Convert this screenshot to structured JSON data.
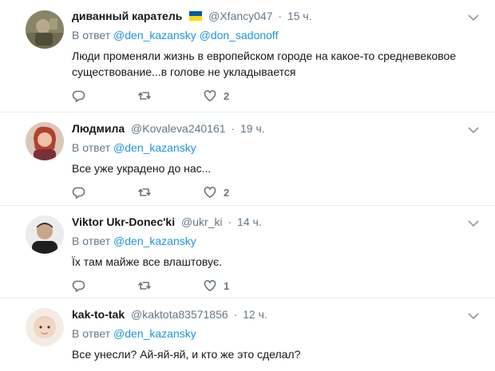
{
  "reply_prefix": "В ответ",
  "tweets": [
    {
      "name": "диванный каратель",
      "has_flag": true,
      "flag_colors": [
        "#0057b7",
        "#ffd700"
      ],
      "handle": "@Xfancy047",
      "separator": "·",
      "time": "15 ч.",
      "mentions": [
        "@den_kazansky",
        "@don_sadonoff"
      ],
      "text": "Люди променяли жизнь в европейском городе на какое-то средневековое существование...в голове не укладывается",
      "likes": "2"
    },
    {
      "name": "Людмила",
      "handle": "@Kovaleva240161",
      "separator": "·",
      "time": "19 ч.",
      "mentions": [
        "@den_kazansky"
      ],
      "text": "Все уже украдено до нас...",
      "likes": "2"
    },
    {
      "name": "Viktor Ukr-Donec'ki",
      "handle": "@ukr_ki",
      "separator": "·",
      "time": "14 ч.",
      "mentions": [
        "@den_kazansky"
      ],
      "text": "Їх там майже все влаштовує.",
      "likes": "1"
    },
    {
      "name": "kak-to-tak",
      "handle": "@kaktota83571856",
      "separator": "·",
      "time": "12 ч.",
      "mentions": [
        "@den_kazansky"
      ],
      "text": "Все унесли? Ай-яй-яй, и кто же это сделал?",
      "likes": ""
    }
  ],
  "icons": {
    "reply": "reply-icon",
    "retweet": "retweet-icon",
    "like": "heart-icon",
    "more": "chevron-down-icon"
  },
  "colors": {
    "text": "#14171a",
    "secondary": "#657786",
    "mention": "#1b95e0",
    "divider": "#e6ecf0"
  }
}
